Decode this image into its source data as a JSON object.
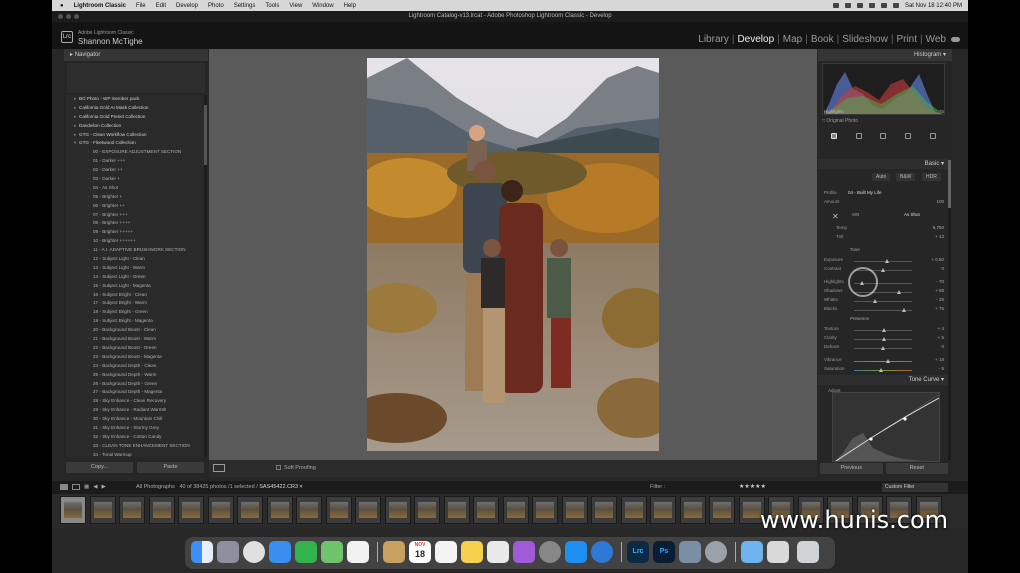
{
  "menubar": {
    "app": "Lightroom Classic",
    "items": [
      "File",
      "Edit",
      "Develop",
      "Photo",
      "Settings",
      "Tools",
      "View",
      "Window",
      "Help"
    ],
    "clock": "Sat Nov 18  12:40 PM"
  },
  "window": {
    "title": "Lightroom Catalog-v13.lrcat - Adobe Photoshop Lightroom Classic - Develop"
  },
  "identity": {
    "product": "Adobe Lightroom Classic",
    "user": "Shannon McTighe",
    "logo": "Lrc"
  },
  "modules": [
    "Library",
    "Develop",
    "Map",
    "Book",
    "Slideshow",
    "Print",
    "Web"
  ],
  "active_module": "Develop",
  "left_panel": {
    "navigator": "Navigator",
    "presets": [
      {
        "label": "BG Photo - WP member pack",
        "kind": "group"
      },
      {
        "label": "California Gold AI Mask Collection",
        "kind": "group"
      },
      {
        "label": "California Gold Preset Collection",
        "kind": "group"
      },
      {
        "label": "Dandelion Collection",
        "kind": "group"
      },
      {
        "label": "GTG - Clean Workflow Collection",
        "kind": "group"
      },
      {
        "label": "GTG - Fleetwood Collection",
        "kind": "group"
      },
      {
        "label": "00 - EXPOSURE ADJUSTMENT SECTION",
        "kind": "sub"
      },
      {
        "label": "01 - Darker +++",
        "kind": "sub"
      },
      {
        "label": "02 - Darker ++",
        "kind": "sub"
      },
      {
        "label": "03 - Darker +",
        "kind": "sub"
      },
      {
        "label": "04 - As Shot",
        "kind": "sub"
      },
      {
        "label": "05 - Brighter +",
        "kind": "sub"
      },
      {
        "label": "06 - Brighter ++",
        "kind": "sub"
      },
      {
        "label": "07 - Brighter +++",
        "kind": "sub"
      },
      {
        "label": "08 - Brighter ++++",
        "kind": "sub"
      },
      {
        "label": "09 - Brighter +++++",
        "kind": "sub"
      },
      {
        "label": "10 - Brighter ++++++",
        "kind": "sub"
      },
      {
        "label": "11 - A.I. ADAPTIVE BRUSHWORK SECTION",
        "kind": "sub"
      },
      {
        "label": "12 - Subject Light - Clean",
        "kind": "sub"
      },
      {
        "label": "13 - Subject Light - Warm",
        "kind": "sub"
      },
      {
        "label": "14 - Subject Light - Green",
        "kind": "sub"
      },
      {
        "label": "15 - Subject Light - Magenta",
        "kind": "sub"
      },
      {
        "label": "16 - Subject Bright - Clean",
        "kind": "sub"
      },
      {
        "label": "17 - Subject Bright - Warm",
        "kind": "sub"
      },
      {
        "label": "18 - Subject Bright - Green",
        "kind": "sub"
      },
      {
        "label": "19 - Subject Bright - Magenta",
        "kind": "sub"
      },
      {
        "label": "20 - Background Boost - Clean",
        "kind": "sub"
      },
      {
        "label": "21 - Background Boost - Warm",
        "kind": "sub"
      },
      {
        "label": "22 - Background Boost - Green",
        "kind": "sub"
      },
      {
        "label": "23 - Background Boost - Magenta",
        "kind": "sub"
      },
      {
        "label": "24 - Background Depth - Clean",
        "kind": "sub"
      },
      {
        "label": "25 - Background Depth - Warm",
        "kind": "sub"
      },
      {
        "label": "26 - Background Depth - Green",
        "kind": "sub"
      },
      {
        "label": "27 - Background Depth - Magenta",
        "kind": "sub"
      },
      {
        "label": "28 - Sky Enhance - Clean Recovery",
        "kind": "sub"
      },
      {
        "label": "29 - Sky Enhance - Radiant Warmth",
        "kind": "sub"
      },
      {
        "label": "30 - Sky Enhance - Mountain Chill",
        "kind": "sub"
      },
      {
        "label": "31 - Sky Enhance - Stormy Grey",
        "kind": "sub"
      },
      {
        "label": "32 - Sky Enhance - Cotton Candy",
        "kind": "sub"
      },
      {
        "label": "33 - CLEAN TONE ENHANCEMENT SECTION",
        "kind": "sub"
      },
      {
        "label": "34 - Tonal Warmup",
        "kind": "sub"
      }
    ],
    "copy_label": "Copy...",
    "paste_label": "Paste"
  },
  "toolbar": {
    "soft_proofing": "Soft Proofing"
  },
  "right_panel": {
    "histogram": "Histogram",
    "highlights_readout": "Highlights",
    "highlights_value": "76",
    "original_photo": "Original Photo",
    "basic": "Basic",
    "treatment_modes": [
      "Auto",
      "B&W",
      "HDR"
    ],
    "profile_label": "Profile",
    "profile_value": "04 - Built My Life",
    "amount_label": "Amount",
    "amount_value": "100",
    "wb_label": "WB",
    "wb_value": "As Shot",
    "temp_label": "Temp",
    "temp_value": "6,750",
    "tint_label": "Tint",
    "tint_value": "+ 13",
    "tone_label": "Tone",
    "presence_label": "Presence",
    "sliders": [
      {
        "label": "Exposure",
        "value": "+ 0.50",
        "pos": 0.58
      },
      {
        "label": "Contrast",
        "value": "0",
        "pos": 0.5
      },
      {
        "label": "Highlights",
        "value": "- 70",
        "pos": 0.15
      },
      {
        "label": "Shadows",
        "value": "+ 58",
        "pos": 0.79
      },
      {
        "label": "Whites",
        "value": "- 25",
        "pos": 0.37
      },
      {
        "label": "Blacks",
        "value": "+ 75",
        "pos": 0.87
      },
      {
        "label": "Texture",
        "value": "+ 4",
        "pos": 0.52
      },
      {
        "label": "Clarity",
        "value": "+ 5",
        "pos": 0.53
      },
      {
        "label": "Dehaze",
        "value": "0",
        "pos": 0.5
      },
      {
        "label": "Vibrance",
        "value": "+ 18",
        "pos": 0.59
      },
      {
        "label": "Saturation",
        "value": "- 5",
        "pos": 0.47
      }
    ],
    "tone_curve": "Tone Curve",
    "adjust_label": "Adjust",
    "previous_label": "Previous",
    "reset_label": "Reset"
  },
  "filmstrip_bar": {
    "source": "All Photographs",
    "info": "40 of 38425 photos /1 selected /",
    "filename": "SAS45422.CR3",
    "filter_label": "Filter :",
    "custom_filter": "Custom Filter"
  },
  "dock": {
    "calendar_month": "NOV",
    "calendar_day": "18",
    "apps": [
      "Finder",
      "Launchpad",
      "Chrome",
      "Mail",
      "FaceTime",
      "Maps",
      "Photos",
      "Notes",
      "Calendar",
      "Reminders",
      "Notes2",
      "Podcasts",
      "Settings",
      "App Store",
      "Camtasia",
      "Lightroom Classic",
      "Photoshop",
      "Image Capture",
      "Screenshot",
      "Folder",
      "Files",
      "Trash"
    ],
    "lrc_label": "Lrc",
    "ps_label": "Ps"
  },
  "watermark": "www.hunis.com"
}
